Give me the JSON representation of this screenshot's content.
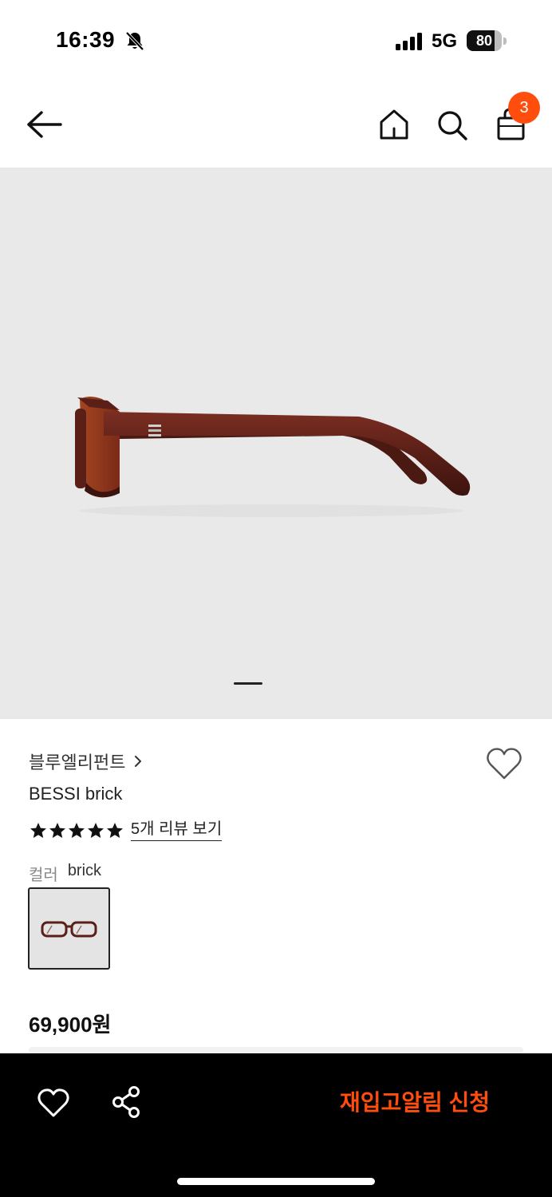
{
  "status_bar": {
    "time": "16:39",
    "network": "5G",
    "battery_percent": 80,
    "battery_label": "80",
    "icons": [
      "bell-slash-icon",
      "cellular-signal-icon",
      "battery-icon"
    ]
  },
  "nav": {
    "icons": [
      "arrow-left-icon",
      "home-icon",
      "search-icon",
      "shopping-bag-icon"
    ],
    "cart_count": "3"
  },
  "gallery": {
    "current_page": 1,
    "image_subject": "glasses-side-view"
  },
  "product": {
    "brand": "블루엘리펀트",
    "name": "BESSI brick",
    "rating_stars": 5,
    "review_link": "5개 리뷰 보기",
    "color_label": "컬러",
    "color_value": "brick",
    "price": "69,900원"
  },
  "bottom_bar": {
    "icons": [
      "heart-icon",
      "share-icon"
    ],
    "restock_button": "재입고알림 신청"
  },
  "colors": {
    "accent": "#ff4d0d",
    "frame_brown": "#5a1f17",
    "image_bg": "#e9e9e9",
    "bottom_bar_bg": "#000000"
  }
}
